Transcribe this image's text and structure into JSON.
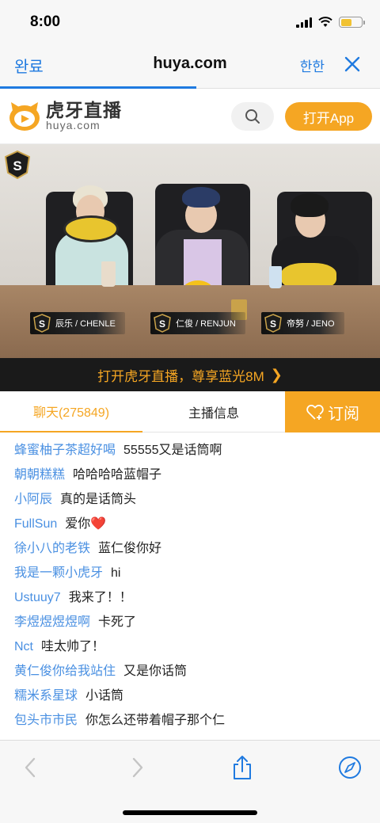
{
  "status": {
    "time": "8:00"
  },
  "browser": {
    "done_label": "완료",
    "url": "huya.com",
    "lang_label": "한한"
  },
  "site": {
    "logo_cn": "虎牙直播",
    "logo_en": "huya.com",
    "open_app_label": "打开App"
  },
  "video": {
    "streamers": [
      {
        "name": "辰乐 / CHENLE"
      },
      {
        "name": "仁俊 / RENJUN"
      },
      {
        "name": "帝努 / JENO"
      }
    ]
  },
  "promo": {
    "text": "打开虎牙直播，尊享蓝光8M"
  },
  "tabs": {
    "chat_label": "聊天(275849)",
    "info_label": "主播信息",
    "subscribe_label": "订阅"
  },
  "chat": [
    {
      "user": "蜂蜜柚子茶超好喝",
      "msg": "55555又是话筒啊"
    },
    {
      "user": "朝朝糕糕",
      "msg": "哈哈哈哈蓝帽子"
    },
    {
      "user": "小阿辰",
      "msg": "真的是话筒头"
    },
    {
      "user": "FullSun",
      "msg": "爱你❤️"
    },
    {
      "user": "徐小八的老铁",
      "msg": "蓝仁俊你好"
    },
    {
      "user": "我是一颗小虎牙",
      "msg": "hi"
    },
    {
      "user": "Ustuuy7",
      "msg": "我来了！！"
    },
    {
      "user": "李煜煜煜煜啊",
      "msg": "卡死了"
    },
    {
      "user": "Nct",
      "msg": "哇太帅了！"
    },
    {
      "user": "黄仁俊你给我站住",
      "msg": "又是你话筒"
    },
    {
      "user": "糯米系星球",
      "msg": "小话筒"
    },
    {
      "user": "包头市市民",
      "msg": "你怎么还带着帽子那个仁"
    }
  ],
  "colors": {
    "accent": "#f5a623",
    "link": "#1f7ae0",
    "username": "#4a90e2"
  }
}
